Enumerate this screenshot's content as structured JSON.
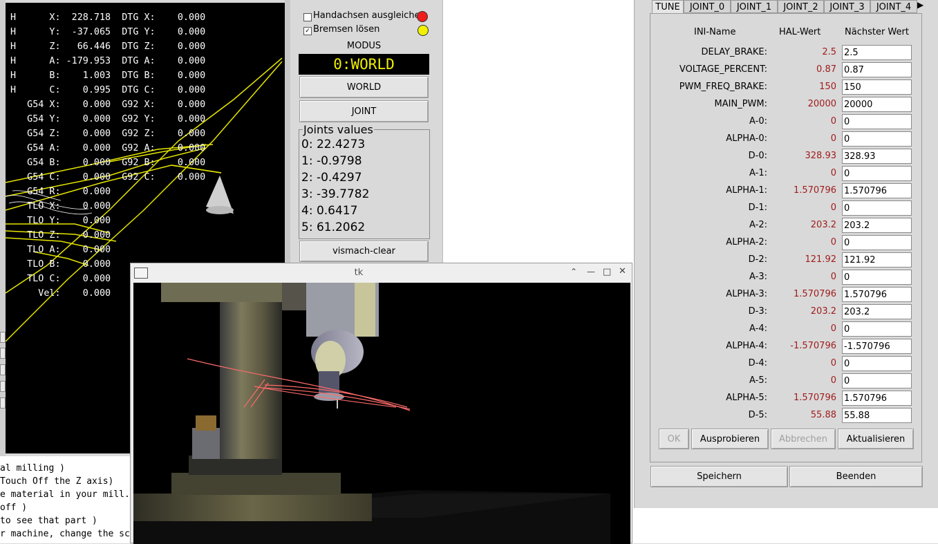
{
  "dro": {
    "lines": [
      "H      X:  228.718  DTG X:    0.000",
      "H      Y:  -37.065  DTG Y:    0.000",
      "H      Z:   66.446  DTG Z:    0.000",
      "H      A: -179.953  DTG A:    0.000",
      "H      B:    1.003  DTG B:    0.000",
      "H      C:    0.995  DTG C:    0.000",
      "   G54 X:    0.000  G92 X:    0.000",
      "   G54 Y:    0.000  G92 Y:    0.000",
      "   G54 Z:    0.000  G92 Z:    0.000",
      "   G54 A:    0.000  G92 A:    0.000",
      "   G54 B:    0.000  G92 B:    0.000",
      "   G54 C:    0.000  G92 C:    0.000",
      "   G54 R:    0.000",
      "   TLO X:    0.000",
      "   TLO Y:    0.000",
      "   TLO Z:    0.000",
      "   TLO A:    0.000",
      "   TLO B:    0.000",
      "   TLO C:    0.000",
      "     Vel:    0.000"
    ]
  },
  "gcode": {
    "lines": [
      "al milling )",
      "Touch Off the Z axis)",
      "e material in your mill.",
      "off )",
      "to see that part )",
      "r machine, change the sc"
    ]
  },
  "middle": {
    "handachsen_label": "Handachsen ausgleichen",
    "bremsen_label": "Bremsen lösen",
    "bremsen_check": "✓",
    "modus_label": "MODUS",
    "modus_value": "0:WORLD",
    "world_button": "WORLD",
    "joint_button": "JOINT",
    "joints_title": "Joints values",
    "joints": [
      "0:  22.4273",
      "1:  -0.9798",
      "2:  -0.4297",
      "3:  -39.7782",
      "4:  0.6417",
      "5:  61.2062"
    ],
    "vismach_button": "vismach-clear",
    "colors": {
      "led_red": "#ee1c1c",
      "led_yellow": "#f0f000",
      "modus_text": "#f0f000"
    }
  },
  "tk": {
    "title": "tk",
    "controls": {
      "up": "⌃",
      "min": "—",
      "max": "□",
      "close": "✕"
    }
  },
  "tune": {
    "tabs": [
      "TUNE",
      "JOINT_0",
      "JOINT_1",
      "JOINT_2",
      "JOINT_3",
      "JOINT_4"
    ],
    "tab_arrow": "▶",
    "headers": {
      "name": "INI-Name",
      "hal": "HAL-Wert",
      "next": "Nächster Wert"
    },
    "rows": [
      {
        "name": "DELAY_BRAKE:",
        "hal": "2.5",
        "next": "2.5"
      },
      {
        "name": "VOLTAGE_PERCENT:",
        "hal": "0.87",
        "next": "0.87"
      },
      {
        "name": "PWM_FREQ_BRAKE:",
        "hal": "150",
        "next": "150"
      },
      {
        "name": "MAIN_PWM:",
        "hal": "20000",
        "next": "20000"
      },
      {
        "name": "A-0:",
        "hal": "0",
        "next": "0"
      },
      {
        "name": "ALPHA-0:",
        "hal": "0",
        "next": "0"
      },
      {
        "name": "D-0:",
        "hal": "328.93",
        "next": "328.93"
      },
      {
        "name": "A-1:",
        "hal": "0",
        "next": "0"
      },
      {
        "name": "ALPHA-1:",
        "hal": "1.570796",
        "next": "1.570796"
      },
      {
        "name": "D-1:",
        "hal": "0",
        "next": "0"
      },
      {
        "name": "A-2:",
        "hal": "203.2",
        "next": "203.2"
      },
      {
        "name": "ALPHA-2:",
        "hal": "0",
        "next": "0"
      },
      {
        "name": "D-2:",
        "hal": "121.92",
        "next": "121.92"
      },
      {
        "name": "A-3:",
        "hal": "0",
        "next": "0"
      },
      {
        "name": "ALPHA-3:",
        "hal": "1.570796",
        "next": "1.570796"
      },
      {
        "name": "D-3:",
        "hal": "203.2",
        "next": "203.2"
      },
      {
        "name": "A-4:",
        "hal": "0",
        "next": "0"
      },
      {
        "name": "ALPHA-4:",
        "hal": "-1.570796",
        "next": "-1.570796"
      },
      {
        "name": "D-4:",
        "hal": "0",
        "next": "0"
      },
      {
        "name": "A-5:",
        "hal": "0",
        "next": "0"
      },
      {
        "name": "ALPHA-5:",
        "hal": "1.570796",
        "next": "1.570796"
      },
      {
        "name": "D-5:",
        "hal": "55.88",
        "next": "55.88"
      }
    ],
    "buttons": {
      "ok": "OK",
      "try": "Ausprobieren",
      "cancel": "Abbrechen",
      "refresh": "Aktualisieren"
    },
    "save": "Speichern",
    "quit": "Beenden",
    "colors": {
      "hal_value": "#a01c1c"
    }
  }
}
